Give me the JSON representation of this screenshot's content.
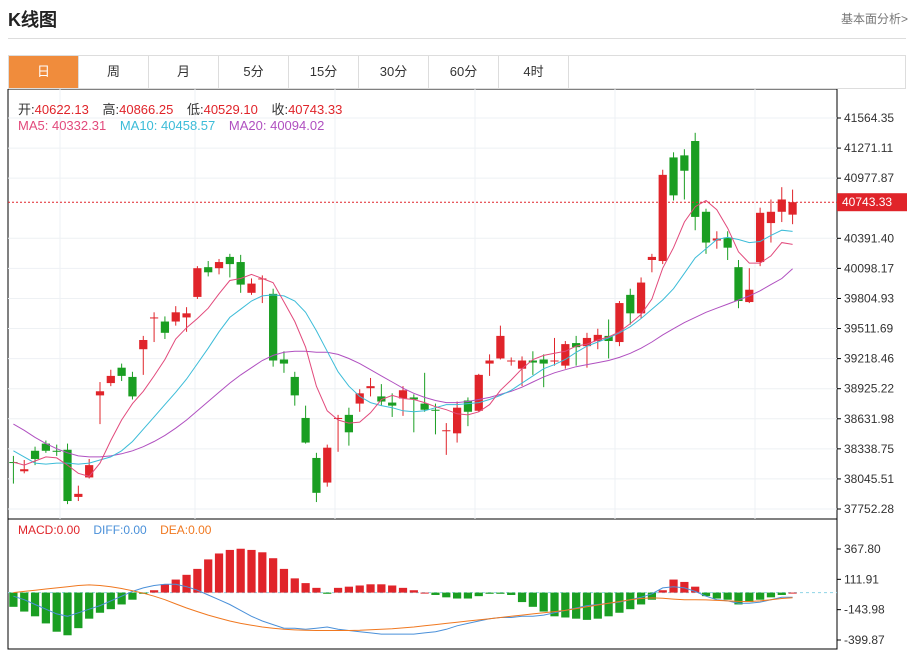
{
  "header": {
    "title": "K线图",
    "link": "基本面分析>"
  },
  "tabs": [
    "日",
    "周",
    "月",
    "5分",
    "15分",
    "30分",
    "60分",
    "4时"
  ],
  "active_tab": "日",
  "ohlc": {
    "open_label": "开:",
    "open": "40622.13",
    "high_label": "高:",
    "high": "40866.25",
    "low_label": "低:",
    "low": "40529.10",
    "close_label": "收:",
    "close": "40743.33"
  },
  "ma": {
    "ma5_label": "MA5:",
    "ma5": "40332.31",
    "ma10_label": "MA10:",
    "ma10": "40458.57",
    "ma20_label": "MA20:",
    "ma20": "40094.02"
  },
  "macd": {
    "macd_label": "MACD:",
    "macd": "0.00",
    "diff_label": "DIFF:",
    "diff": "0.00",
    "dea_label": "DEA:",
    "dea": "0.00"
  },
  "colors": {
    "up": "#e0242a",
    "down": "#1a9e22",
    "ma5": "#e24a7c",
    "ma10": "#3cbcd8",
    "ma20": "#b050c0",
    "dea": "#f07820",
    "diff": "#4a90d9",
    "accent": "#f08c3c"
  },
  "chart_data": [
    {
      "type": "candlestick",
      "price_ticks": [
        "41564.35",
        "41271.11",
        "40977.87",
        "40391.40",
        "40098.17",
        "39804.93",
        "39511.69",
        "39218.46",
        "38925.22",
        "38631.98",
        "38338.75",
        "38045.51",
        "37752.28"
      ],
      "ylim": [
        37752.28,
        41564.35
      ],
      "last_price": "40743.33",
      "candles": [
        [
          38210,
          38205,
          38270,
          38000
        ],
        [
          38120,
          38140,
          38230,
          38100
        ],
        [
          38320,
          38240,
          38360,
          38180
        ],
        [
          38390,
          38320,
          38420,
          38300
        ],
        [
          38320,
          38310,
          38380,
          38270
        ],
        [
          38330,
          37830,
          38390,
          37800
        ],
        [
          37870,
          37900,
          37980,
          37830
        ],
        [
          38060,
          38180,
          38240,
          38050
        ],
        [
          38860,
          38900,
          38990,
          38580
        ],
        [
          38980,
          39050,
          39110,
          38950
        ],
        [
          39130,
          39050,
          39170,
          39000
        ],
        [
          39040,
          38850,
          39090,
          38820
        ],
        [
          39310,
          39400,
          39440,
          39060
        ],
        [
          39610,
          39620,
          39670,
          39380
        ],
        [
          39580,
          39470,
          39630,
          39410
        ],
        [
          39580,
          39670,
          39730,
          39540
        ],
        [
          39620,
          39660,
          39720,
          39480
        ],
        [
          39820,
          40100,
          40120,
          39800
        ],
        [
          40110,
          40060,
          40170,
          40020
        ],
        [
          40100,
          40160,
          40190,
          40040
        ],
        [
          40210,
          40140,
          40240,
          40010
        ],
        [
          40160,
          39940,
          40230,
          39860
        ],
        [
          39860,
          39950,
          40000,
          39840
        ],
        [
          40000,
          40000,
          40030,
          39760
        ],
        [
          39850,
          39200,
          39900,
          39140
        ],
        [
          39210,
          39170,
          39290,
          39080
        ],
        [
          39040,
          38860,
          39090,
          38760
        ],
        [
          38640,
          38400,
          38760,
          38390
        ],
        [
          38250,
          37910,
          38300,
          37820
        ],
        [
          38010,
          38350,
          38380,
          37970
        ],
        [
          38630,
          38640,
          38670,
          38310
        ],
        [
          38670,
          38500,
          38740,
          38370
        ],
        [
          38780,
          38880,
          38920,
          38700
        ],
        [
          38930,
          38950,
          39030,
          38850
        ],
        [
          38850,
          38800,
          38970,
          38760
        ],
        [
          38790,
          38760,
          38880,
          38650
        ],
        [
          38830,
          38910,
          38950,
          38660
        ],
        [
          38840,
          38820,
          38870,
          38500
        ],
        [
          38780,
          38720,
          39080,
          38700
        ],
        [
          38720,
          38710,
          38780,
          38480
        ],
        [
          38520,
          38520,
          38590,
          38280
        ],
        [
          38490,
          38740,
          38800,
          38400
        ],
        [
          38810,
          38700,
          38840,
          38560
        ],
        [
          38710,
          39060,
          39070,
          38700
        ],
        [
          39170,
          39200,
          39260,
          39050
        ],
        [
          39220,
          39440,
          39540,
          39210
        ],
        [
          39200,
          39200,
          39230,
          39150
        ],
        [
          39120,
          39200,
          39240,
          38950
        ],
        [
          39200,
          39180,
          39290,
          39060
        ],
        [
          39210,
          39170,
          39260,
          38940
        ],
        [
          39200,
          39200,
          39420,
          39150
        ],
        [
          39150,
          39360,
          39390,
          39120
        ],
        [
          39370,
          39330,
          39440,
          39150
        ],
        [
          39340,
          39420,
          39470,
          39130
        ],
        [
          39390,
          39450,
          39510,
          39310
        ],
        [
          39440,
          39390,
          39600,
          39220
        ],
        [
          39380,
          39760,
          39780,
          39340
        ],
        [
          39840,
          39660,
          39900,
          39550
        ],
        [
          39660,
          39960,
          40010,
          39610
        ],
        [
          40180,
          40210,
          40240,
          40060
        ],
        [
          40170,
          41010,
          41060,
          40140
        ],
        [
          41180,
          40810,
          41230,
          40760
        ],
        [
          41200,
          41050,
          41260,
          40770
        ],
        [
          41340,
          40600,
          41420,
          40470
        ],
        [
          40650,
          40350,
          40680,
          40240
        ],
        [
          40370,
          40390,
          40460,
          40290
        ],
        [
          40400,
          40300,
          40460,
          40180
        ],
        [
          40110,
          39780,
          40180,
          39710
        ],
        [
          39770,
          39890,
          40100,
          39760
        ],
        [
          40160,
          40640,
          40690,
          40120
        ],
        [
          40540,
          40650,
          40770,
          40350
        ],
        [
          40650,
          40770,
          40890,
          40550
        ],
        [
          40622.13,
          40743.33,
          40866.25,
          40529.1
        ]
      ],
      "ma5": [
        38210,
        38180,
        38220,
        38260,
        38250,
        38180,
        38100,
        38070,
        38200,
        38420,
        38620,
        38780,
        38900,
        39050,
        39210,
        39410,
        39520,
        39610,
        39710,
        39850,
        39980,
        40000,
        40040,
        40000,
        39960,
        39770,
        39580,
        39330,
        38950,
        38710,
        38620,
        38590,
        38600,
        38690,
        38820,
        38860,
        38830,
        38820,
        38790,
        38750,
        38720,
        38680,
        38670,
        38700,
        38770,
        38910,
        39010,
        39120,
        39210,
        39250,
        39270,
        39290,
        39340,
        39360,
        39400,
        39430,
        39480,
        39560,
        39650,
        39800,
        40100,
        40300,
        40550,
        40700,
        40760,
        40670,
        40490,
        40260,
        40150,
        40150,
        40220,
        40350,
        40332.31
      ],
      "ma10": [
        38320,
        38260,
        38200,
        38190,
        38200,
        38200,
        38190,
        38200,
        38230,
        38260,
        38320,
        38410,
        38530,
        38650,
        38770,
        38890,
        39020,
        39170,
        39320,
        39480,
        39620,
        39700,
        39780,
        39830,
        39840,
        39830,
        39780,
        39670,
        39490,
        39290,
        39090,
        38950,
        38850,
        38790,
        38760,
        38740,
        38710,
        38700,
        38710,
        38740,
        38770,
        38770,
        38780,
        38790,
        38820,
        38860,
        38910,
        38980,
        39050,
        39120,
        39160,
        39210,
        39280,
        39340,
        39380,
        39420,
        39470,
        39530,
        39610,
        39700,
        39790,
        39900,
        40050,
        40200,
        40290,
        40380,
        40400,
        40380,
        40350,
        40360,
        40420,
        40470,
        40458.57
      ],
      "ma20": [
        38580,
        38520,
        38450,
        38390,
        38340,
        38300,
        38270,
        38260,
        38260,
        38270,
        38290,
        38320,
        38360,
        38410,
        38470,
        38540,
        38620,
        38710,
        38800,
        38890,
        38980,
        39060,
        39130,
        39200,
        39250,
        39280,
        39290,
        39290,
        39280,
        39280,
        39260,
        39220,
        39170,
        39110,
        39050,
        38990,
        38930,
        38880,
        38840,
        38810,
        38790,
        38790,
        38800,
        38820,
        38840,
        38870,
        38900,
        38940,
        38990,
        39040,
        39080,
        39110,
        39140,
        39160,
        39180,
        39200,
        39230,
        39270,
        39320,
        39380,
        39450,
        39510,
        39570,
        39620,
        39670,
        39710,
        39750,
        39790,
        39830,
        39880,
        39940,
        40000,
        40094.02
      ]
    },
    {
      "type": "bar",
      "indicator": "MACD",
      "ticks": [
        "367.80",
        "111.91",
        "-143.98",
        "-399.87"
      ],
      "ylim": [
        -399.87,
        367.8
      ],
      "macd": [
        -120,
        -160,
        -200,
        -260,
        -330,
        -360,
        -300,
        -220,
        -170,
        -140,
        -100,
        -60,
        -10,
        20,
        70,
        110,
        150,
        200,
        280,
        330,
        360,
        370,
        360,
        340,
        290,
        200,
        120,
        80,
        40,
        -10,
        40,
        50,
        60,
        70,
        70,
        60,
        40,
        20,
        0,
        -20,
        -40,
        -50,
        -50,
        -30,
        -10,
        -10,
        -20,
        -80,
        -120,
        -160,
        -200,
        -210,
        -220,
        -230,
        -220,
        -200,
        -170,
        -140,
        -100,
        -60,
        20,
        110,
        90,
        50,
        -30,
        -50,
        -60,
        -100,
        -80,
        -60,
        -40,
        -20,
        0
      ],
      "diff": [
        -30,
        -60,
        -100,
        -140,
        -180,
        -200,
        -170,
        -140,
        -110,
        -70,
        -30,
        10,
        40,
        60,
        70,
        70,
        50,
        20,
        -20,
        -60,
        -100,
        -150,
        -200,
        -240,
        -270,
        -300,
        -300,
        -310,
        -300,
        -290,
        -310,
        -320,
        -330,
        -340,
        -350,
        -350,
        -350,
        -350,
        -340,
        -330,
        -310,
        -280,
        -260,
        -240,
        -220,
        -210,
        -210,
        -200,
        -200,
        -190,
        -170,
        -150,
        -130,
        -110,
        -100,
        -90,
        -80,
        -60,
        -40,
        -10,
        40,
        50,
        40,
        10,
        -30,
        -60,
        -70,
        -90,
        -90,
        -80,
        -60,
        -40,
        -40
      ],
      "dea": [
        0,
        10,
        20,
        30,
        40,
        50,
        60,
        65,
        60,
        50,
        35,
        15,
        -5,
        -30,
        -60,
        -95,
        -130,
        -160,
        -190,
        -215,
        -240,
        -260,
        -275,
        -290,
        -300,
        -310,
        -315,
        -318,
        -320,
        -320,
        -320,
        -320,
        -318,
        -314,
        -310,
        -305,
        -298,
        -290,
        -280,
        -270,
        -260,
        -250,
        -240,
        -230,
        -220,
        -210,
        -200,
        -190,
        -180,
        -170,
        -160,
        -150,
        -135,
        -120,
        -105,
        -90,
        -75,
        -60,
        -50,
        -45,
        -48,
        -55,
        -60,
        -60,
        -62,
        -66,
        -70,
        -74,
        -75,
        -70,
        -60,
        -50,
        -44
      ]
    }
  ]
}
